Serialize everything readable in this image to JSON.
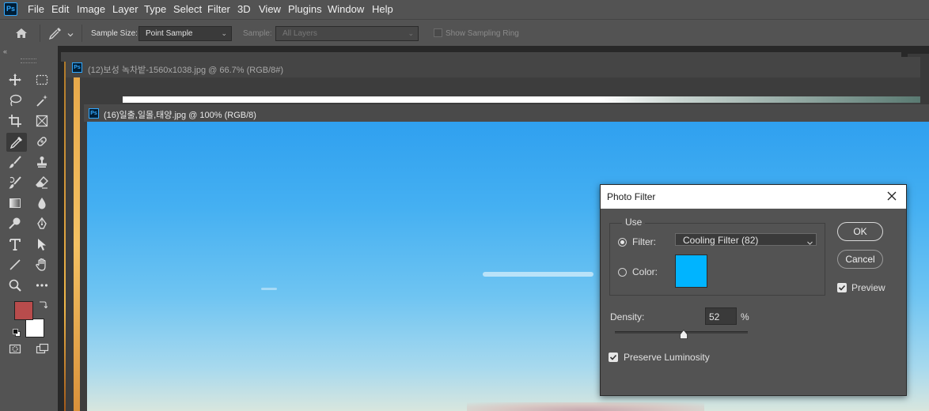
{
  "app": {
    "logo_text": "Ps"
  },
  "menu": [
    "File",
    "Edit",
    "Image",
    "Layer",
    "Type",
    "Select",
    "Filter",
    "3D",
    "View",
    "Plugins",
    "Window",
    "Help"
  ],
  "options_bar": {
    "sample_size_label": "Sample Size:",
    "sample_size_value": "Point Sample",
    "sample_label": "Sample:",
    "sample_value": "All Layers",
    "show_sampling_ring_label": "Show Sampling Ring"
  },
  "documents": [
    {
      "title": "(12)보성 녹차밭-1560x1038.jpg @ 66.7% (RGB/8#)"
    },
    {
      "title": "(16)일출,일몰,태양.jpg @ 100% (RGB/8)"
    }
  ],
  "colors": {
    "foreground": "#b84c4c",
    "background": "#ffffff",
    "filter_swatch": "#00b4ff",
    "accent": "#31a8ff"
  },
  "dialog": {
    "title": "Photo Filter",
    "use_legend": "Use",
    "filter_label": "Filter:",
    "filter_value": "Cooling Filter (82)",
    "color_label": "Color:",
    "density_label": "Density:",
    "density_value": "52",
    "density_unit": "%",
    "preserve_luminosity_label": "Preserve Luminosity",
    "ok_label": "OK",
    "cancel_label": "Cancel",
    "preview_label": "Preview",
    "filter_mode": "filter",
    "preserve_luminosity_checked": true,
    "preview_checked": true
  }
}
